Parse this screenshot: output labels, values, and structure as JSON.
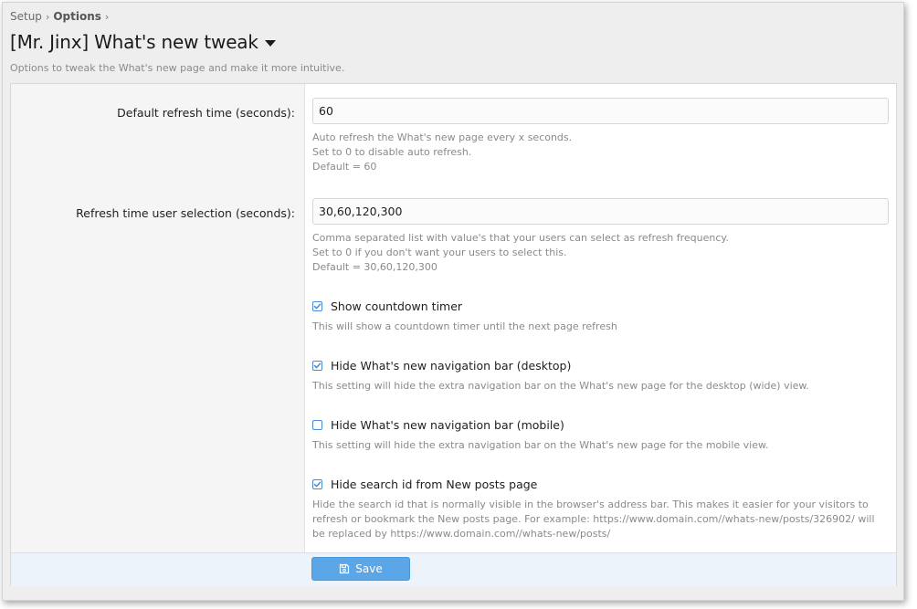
{
  "breadcrumb": {
    "items": [
      "Setup",
      "Options"
    ]
  },
  "page": {
    "title": "[Mr. Jinx] What's new tweak",
    "subtitle": "Options to tweak the What's new page and make it more intuitive."
  },
  "options": {
    "refresh_time": {
      "label": "Default refresh time (seconds):",
      "value": "60",
      "hints": [
        "Auto refresh the What's new page every x seconds.",
        "Set to 0 to disable auto refresh.",
        "Default = 60"
      ]
    },
    "refresh_selection": {
      "label": "Refresh time user selection (seconds):",
      "value": "30,60,120,300",
      "hints": [
        "Comma separated list with value's that your users can select as refresh frequency.",
        "Set to 0 if you don't want your users to select this.",
        "Default = 30,60,120,300"
      ]
    },
    "checkboxes": [
      {
        "label": "Show countdown timer",
        "checked": true,
        "hint": "This will show a countdown timer until the next page refresh"
      },
      {
        "label": "Hide What's new navigation bar (desktop)",
        "checked": true,
        "hint": "This setting will hide the extra navigation bar on the What's new page for the desktop (wide) view."
      },
      {
        "label": "Hide What's new navigation bar (mobile)",
        "checked": false,
        "hint": "This setting will hide the extra navigation bar on the What's new page for the mobile view."
      },
      {
        "label": "Hide search id from New posts page",
        "checked": true,
        "hint": "Hide the search id that is normally visible in the browser's address bar. This makes it easier for your visitors to refresh or bookmark the New posts page. For example: https://www.domain.com//whats-new/posts/326902/ will be replaced by https://www.domain.com//whats-new/posts/"
      }
    ]
  },
  "footer": {
    "save_label": "Save"
  },
  "icons": {
    "save": "floppy-disk-icon",
    "checkbox": "check-icon",
    "caret": "caret-down-icon",
    "chevron": "chevron-right-icon"
  },
  "colors": {
    "accent": "#5aa6e6",
    "checkbox_border": "#4a8bd0",
    "footer_bg": "#edf3fa"
  }
}
